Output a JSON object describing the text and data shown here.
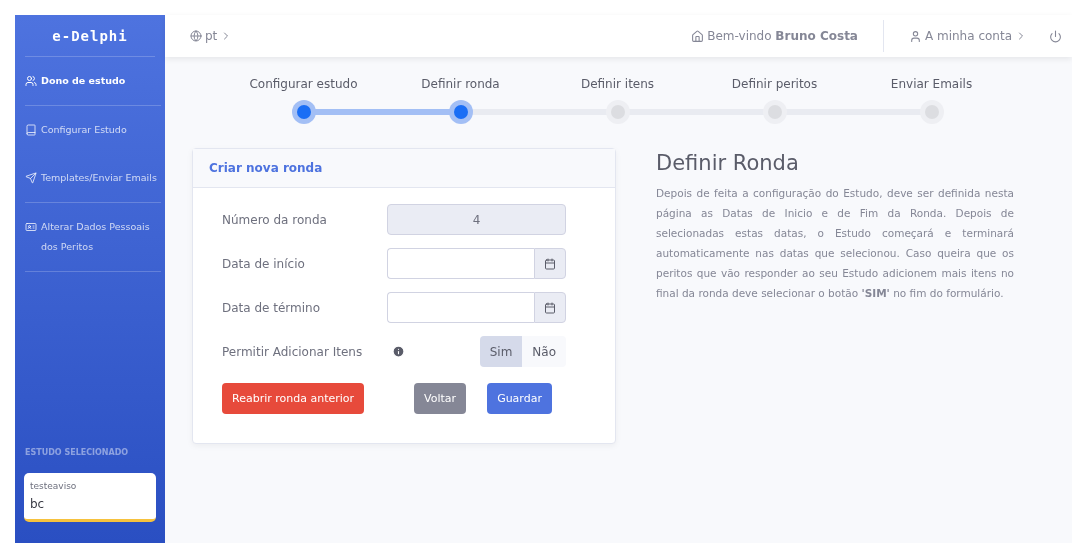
{
  "sidebar": {
    "logo": "e-Delphi",
    "items": [
      {
        "label": "Dono de estudo",
        "selected": true,
        "divider": true
      },
      {
        "label": "Configurar Estudo",
        "selected": false,
        "divider": false
      },
      {
        "label": "Templates/Enviar Emails",
        "selected": false,
        "divider": true
      },
      {
        "label": "Alterar Dados Pessoais dos Peritos",
        "selected": false,
        "divider": true
      }
    ],
    "section_heading": "ESTUDO SELECIONADO",
    "study_card": {
      "title": "testeaviso",
      "value": "bc"
    }
  },
  "topbar": {
    "language": "pt",
    "welcome": "Bem-vindo **Bruno Costa**",
    "account": "A minha conta"
  },
  "steps": [
    {
      "label": "Configurar estudo",
      "completed": true
    },
    {
      "label": "Definir ronda",
      "completed": true
    },
    {
      "label": "Definir itens",
      "completed": false
    },
    {
      "label": "Definir peritos",
      "completed": false
    },
    {
      "label": "Enviar Emails",
      "completed": false
    }
  ],
  "form": {
    "title": "Criar nova ronda",
    "fields": [
      {
        "kind": "readonly",
        "label": "Número da ronda",
        "value": "4"
      },
      {
        "kind": "date",
        "label": "Data de início"
      },
      {
        "kind": "date",
        "label": "Data de término"
      }
    ],
    "toggle": {
      "label": "Permitir Adicionar Itens",
      "options": [
        {
          "label": "Sim",
          "selected": true
        },
        {
          "label": "Não",
          "selected": false
        }
      ]
    },
    "buttons": [
      {
        "label": "Reabrir ronda anterior",
        "kind": "danger"
      },
      {
        "label": "Voltar",
        "kind": "secondary"
      },
      {
        "label": "Guardar",
        "kind": "primary"
      }
    ]
  },
  "help": {
    "title": "Definir Ronda",
    "text": "Depois de feita a configuração do Estudo, deve ser definida nesta página as Datas de Inicio e de Fim da Ronda. Depois de selecionadas estas datas, o Estudo começará e terminará automaticamente nas datas que selecionou. Caso queira que os peritos que vão responder ao seu Estudo adicionem mais itens no final da ronda deve selecionar o botão **'SIM'** no fim do formulário."
  }
}
